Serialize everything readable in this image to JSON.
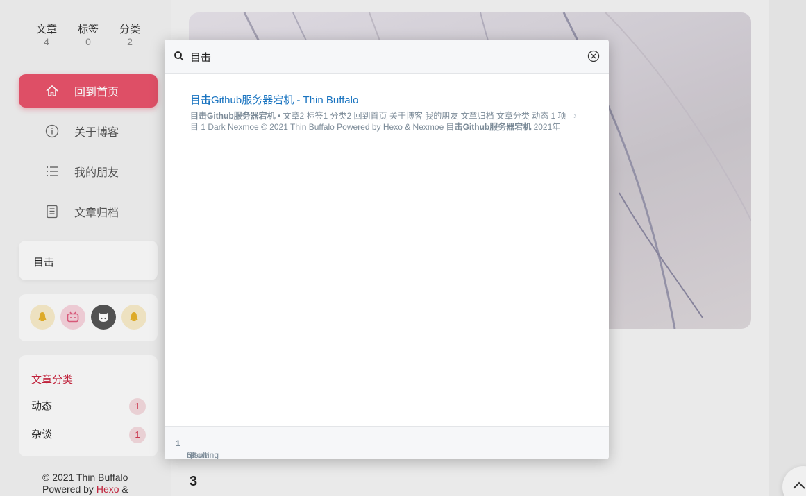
{
  "stats": [
    {
      "label": "文章",
      "value": "4"
    },
    {
      "label": "标签",
      "value": "0"
    },
    {
      "label": "分类",
      "value": "2"
    }
  ],
  "nav": [
    {
      "label": "回到首页",
      "icon": "home-icon"
    },
    {
      "label": "关于博客",
      "icon": "info-icon"
    },
    {
      "label": "我的朋友",
      "icon": "list-icon"
    },
    {
      "label": "文章归档",
      "icon": "archive-icon"
    }
  ],
  "sidebar_search": {
    "value": "目击"
  },
  "social": [
    {
      "icon": "qq-icon",
      "bg": "#f7ebc8",
      "fg": "#e6b12a"
    },
    {
      "icon": "bilibili-icon",
      "bg": "#f6d3dc",
      "fg": "#e05c7e"
    },
    {
      "icon": "github-icon",
      "bg": "#555555",
      "fg": "#ffffff"
    },
    {
      "icon": "qq-icon",
      "bg": "#f7ebc8",
      "fg": "#e6b12a"
    }
  ],
  "categories": {
    "title": "文章分类",
    "items": [
      {
        "name": "动态",
        "count": "1"
      },
      {
        "name": "杂谈",
        "count": "1"
      }
    ]
  },
  "footer": {
    "line1": "© 2021 Thin Buffalo",
    "powered": "Powered by",
    "hexo": "Hexo",
    "amp": "&"
  },
  "main": {
    "post_number": "3"
  },
  "search": {
    "query": "目击",
    "result": {
      "title_highlight": "目击",
      "title_rest": "Github服务器宕机 - Thin Buffalo",
      "snippet_highlight": "目击Github服务器宕机",
      "snippet_line1_rest": " • 文章2 标签1 分类2 回到首页 关于博客 我的朋友 文章归档 文章分类 动态 1 项",
      "snippet_line2_start": "目 1 Dark Nexmoe © 2021 Thin Buffalo Powered by Hexo & Nexmoe ",
      "snippet_line2_highlight": "目击Github服务器宕机",
      "snippet_line2_end": " 2021年"
    },
    "footer": {
      "showing": "Showing ",
      "count": "1",
      "result_for": " result for ",
      "query_quoted": "“目击”"
    }
  },
  "colors": {
    "accent": "#e8536b",
    "link": "#1a74c0",
    "category": "#c8243e"
  }
}
